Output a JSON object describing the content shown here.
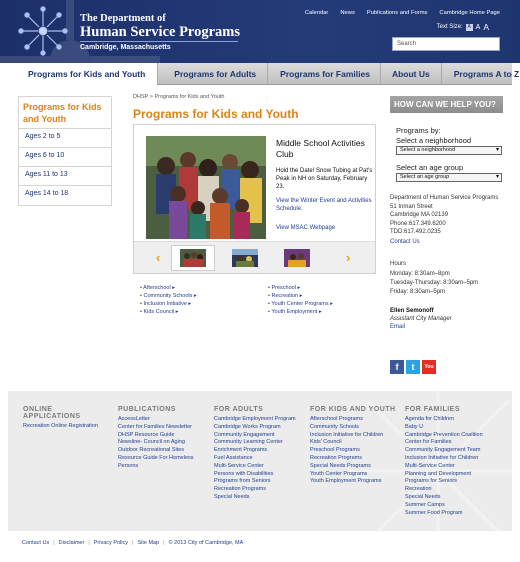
{
  "header": {
    "dept_title": "The Department of",
    "dept_name": "Human Service Programs",
    "dept_city": "Cambridge, Massachusetts",
    "utility_links": [
      "Calendar",
      "News",
      "Publications and Forms",
      "Cambridge Home Page"
    ],
    "text_size_label": "Text Size:",
    "text_size_options": [
      "A",
      "A",
      "A"
    ],
    "search_placeholder": "Search"
  },
  "nav": {
    "items": [
      "Programs for Kids and Youth",
      "Programs for Adults",
      "Programs for Families",
      "About Us",
      "Programs A to Z"
    ]
  },
  "sidebar": {
    "title": "Programs for Kids and Youth",
    "items": [
      "Ages 2 to 5",
      "Ages 6 to 10",
      "Ages 11 to 13",
      "Ages 14 to 18"
    ]
  },
  "main": {
    "breadcrumb": "DHSP > Programs for Kids and Youth",
    "title": "Programs for Kids and Youth",
    "feature": {
      "title": "Middle School Activities Club",
      "body": "Hold the Date! Snow Tubing at Pat's Peak in NH on Saturday, February 23.",
      "link1": "View the Winter Event and Activities Schedule.",
      "link2": "View MSAC Webpage"
    },
    "links_left": [
      "Afterschool ▸",
      "Community Schools ▸",
      "Inclusion Initiative ▸",
      "Kids Council ▸"
    ],
    "links_right": [
      "Preschool ▸",
      "Recreation ▸",
      "Youth Center Programs ▸",
      "Youth Employment ▸"
    ]
  },
  "right": {
    "help_title": "HOW CAN WE HELP YOU?",
    "programs_by": "Programs by:",
    "select_neighborhood_label": "Select a neighborhood",
    "select_neighborhood_value": "Select a neighborhood",
    "select_age_label": "Select an age group",
    "select_age_value": "Select an age group",
    "contact_name": "Department of Human Service Programs",
    "address1": "51 Inman Street",
    "address2": "Cambridge MA 02139",
    "phone": "Phone:617.349.6200",
    "tdd": "TDD:617.492.0235",
    "contact_link": "Contact Us",
    "hours_title": "Hours",
    "hours1": "Monday: 8:30am–8pm",
    "hours2": "Tuesday-Thursday: 8:30am–5pm",
    "hours3": "Friday: 8:30am–5pm",
    "manager_name": "Ellen Semonoff",
    "manager_title": "Assistant City Manager",
    "email_link": "Email",
    "social": [
      "f",
      "t",
      "You"
    ]
  },
  "footer": {
    "columns": [
      {
        "heading": "ONLINE APPLICATIONS",
        "items": [
          "Recreation Online Registration"
        ]
      },
      {
        "heading": "PUBLICATIONS",
        "items": [
          "AccessLetter",
          "Center for Families Newsletter",
          "DHSP Resource Guide",
          "Newsline- Council on Aging",
          "Outdoor Recreational Sites",
          "Resource Guide For Homeless Persons"
        ]
      },
      {
        "heading": "FOR ADULTS",
        "items": [
          "Cambridge Employment Program",
          "Cambridge Works Program",
          "Community Engagement",
          "Community Learning Center",
          "Enrichment Programs",
          "Fuel Assistance",
          "Multi-Service Center",
          "Persons with Disabilities",
          "Programs from Seniors",
          "Recreation Programs",
          "Special Needs"
        ]
      },
      {
        "heading": "FOR KIDS AND YOUTH",
        "items": [
          "Afterschool Programs",
          "Community Schools",
          "Inclusion Initiative for Children",
          "Kids' Council",
          "Preschool Programs",
          "Recreation Programs",
          "Special Needs Programs",
          "Youth Center Programs",
          "Youth Employment Programs"
        ]
      },
      {
        "heading": "FOR FAMILIES",
        "items": [
          "Agenda for Children",
          "Baby U",
          "Cambridge Prevention Coalition",
          "Center for Families",
          "Community Engagement Team",
          "Inclusion Initiative for Children",
          "Multi-Service Center",
          "Planning and Development",
          "Programs for Seniors",
          "Recreation",
          "Special Needs",
          "Summer Camps",
          "Summer Food Program"
        ]
      }
    ],
    "bottom_links": [
      "Contact Us",
      "Disclaimer",
      "Privacy Policy",
      "Site Map"
    ],
    "copyright": "© 2013 City of Cambridge, MA"
  }
}
